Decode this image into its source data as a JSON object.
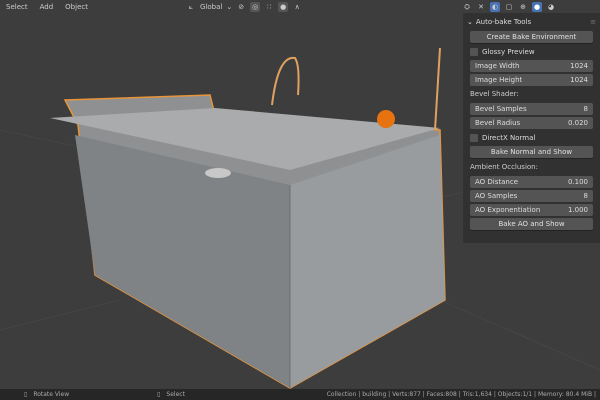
{
  "topbar": {
    "menus": [
      "Select",
      "Add",
      "Object"
    ],
    "orientation": "Global"
  },
  "panel": {
    "title": "Auto-bake Tools",
    "create_env": "Create Bake Environment",
    "glossy": "Glossy Preview",
    "image_width": {
      "label": "Image Width",
      "value": "1024"
    },
    "image_height": {
      "label": "Image Height",
      "value": "1024"
    },
    "bevel_section": "Bevel Shader:",
    "bevel_samples": {
      "label": "Bevel Samples",
      "value": "8"
    },
    "bevel_radius": {
      "label": "Bevel Radius",
      "value": "0.020"
    },
    "directx": "DirectX Normal",
    "bake_normal": "Bake Normal and Show",
    "ao_section": "Ambient Occlusion:",
    "ao_distance": {
      "label": "AO Distance",
      "value": "0.100"
    },
    "ao_samples": {
      "label": "AO Samples",
      "value": "8"
    },
    "ao_exp": {
      "label": "AO Exponentiation",
      "value": "1.000"
    },
    "bake_ao": "Bake AO and Show"
  },
  "status": {
    "rotate": "Rotate View",
    "select": "Select",
    "stats": "Collection | building | Verts:877 | Faces:808 | Tris:1,634 | Objects:1/1 | Memory: 80.4 MiB |"
  },
  "colors": {
    "accent": "#e8953a",
    "selection": "#e8953a"
  }
}
